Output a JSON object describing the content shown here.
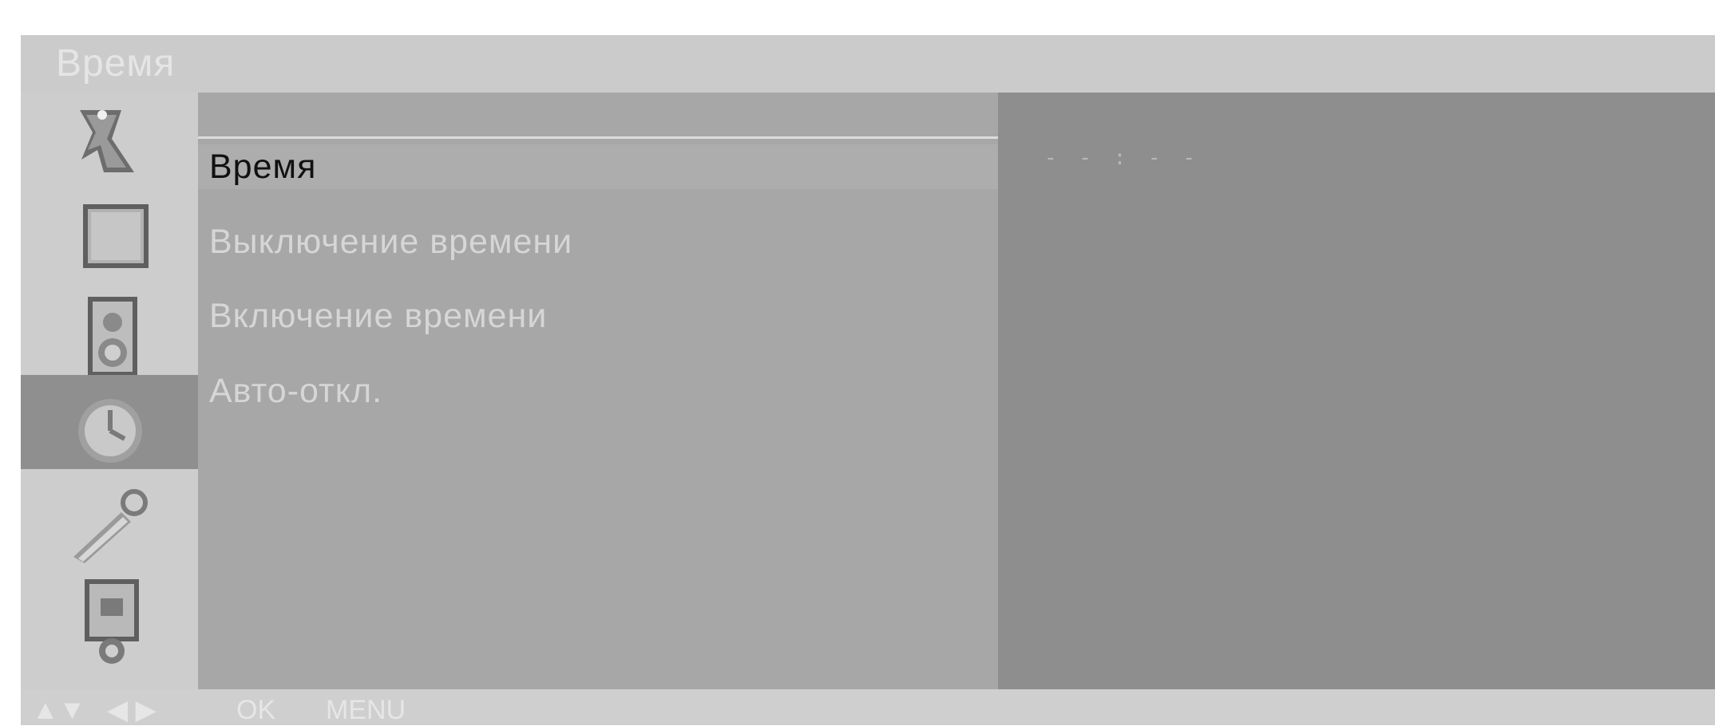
{
  "header": {
    "title": "Время"
  },
  "sidebar": {
    "items": [
      {
        "icon": "satellite-dish-icon"
      },
      {
        "icon": "picture-icon"
      },
      {
        "icon": "speaker-icon"
      },
      {
        "icon": "clock-icon",
        "selected": true
      },
      {
        "icon": "wrench-icon"
      },
      {
        "icon": "input-source-icon"
      }
    ]
  },
  "menu": {
    "items": [
      {
        "label": "Время",
        "selected": true
      },
      {
        "label": "Выключение времени"
      },
      {
        "label": "Включение времени"
      },
      {
        "label": "Авто-откл."
      }
    ]
  },
  "value_panel": {
    "time": "- - : - -"
  },
  "footer": {
    "updown": "▲▼",
    "leftright": "◀ ▶",
    "ok": "OK",
    "menu": "MENU"
  },
  "colors": {
    "menu_bg": "#a7a7a7",
    "value_bg": "#8d8e8d",
    "frame_bg": "#cbcbcb",
    "selected_icon_bg": "#8f8f8f"
  }
}
